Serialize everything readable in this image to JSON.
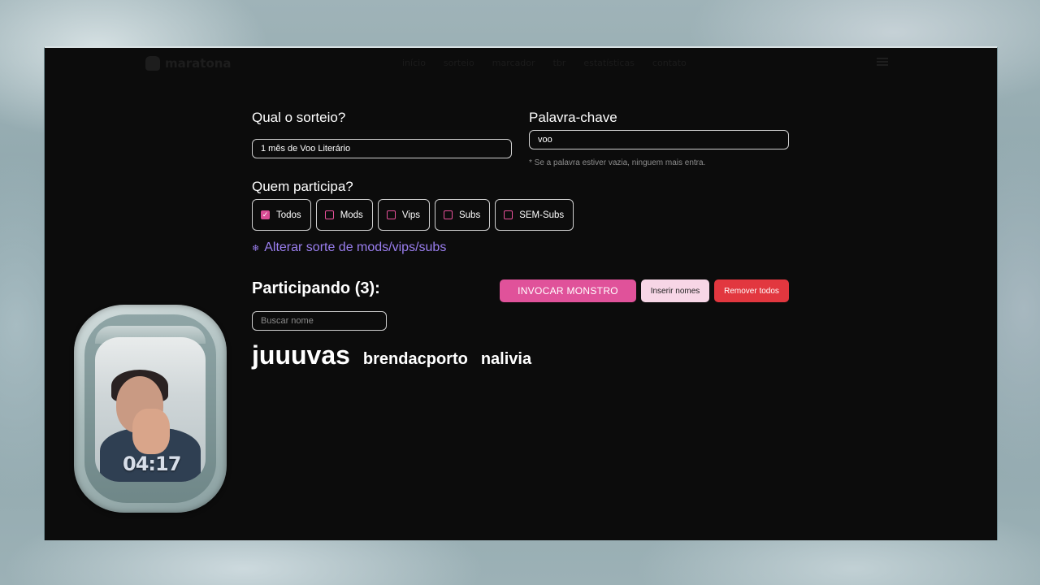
{
  "nav": {
    "logo": "maratona",
    "links": [
      "início",
      "sorteio",
      "marcador",
      "tbr",
      "estatísticas",
      "contato"
    ]
  },
  "form": {
    "draw_label": "Qual o sorteio?",
    "draw_value": "1 mês de Voo Literário",
    "keyword_label": "Palavra-chave",
    "keyword_value": "voo",
    "keyword_hint": "* Se a palavra estiver vazia, ninguem mais entra.",
    "who_label": "Quem participa?",
    "options": [
      {
        "label": "Todos",
        "checked": true
      },
      {
        "label": "Mods",
        "checked": false
      },
      {
        "label": "Vips",
        "checked": false
      },
      {
        "label": "Subs",
        "checked": false
      },
      {
        "label": "SEM-Subs",
        "checked": false
      }
    ],
    "luck_link": "Alterar sorte de mods/vips/subs",
    "luck_icon": "snowflake-icon"
  },
  "participants": {
    "title": "Participando (3):",
    "search_placeholder": "Buscar nome",
    "names": [
      "juuuvas",
      "brendacporto",
      "nalivia"
    ]
  },
  "actions": {
    "summon": "INVOCAR MONSTRO",
    "insert": "Inserir nomes",
    "remove": "Remover todos"
  },
  "webcam": {
    "timer": "04:17"
  },
  "colors": {
    "accent_pink": "#e0529a",
    "accent_purple": "#9b7ff0",
    "danger_red": "#e2373f",
    "light_pink": "#f7d6e6",
    "background": "#0c0c0c"
  }
}
